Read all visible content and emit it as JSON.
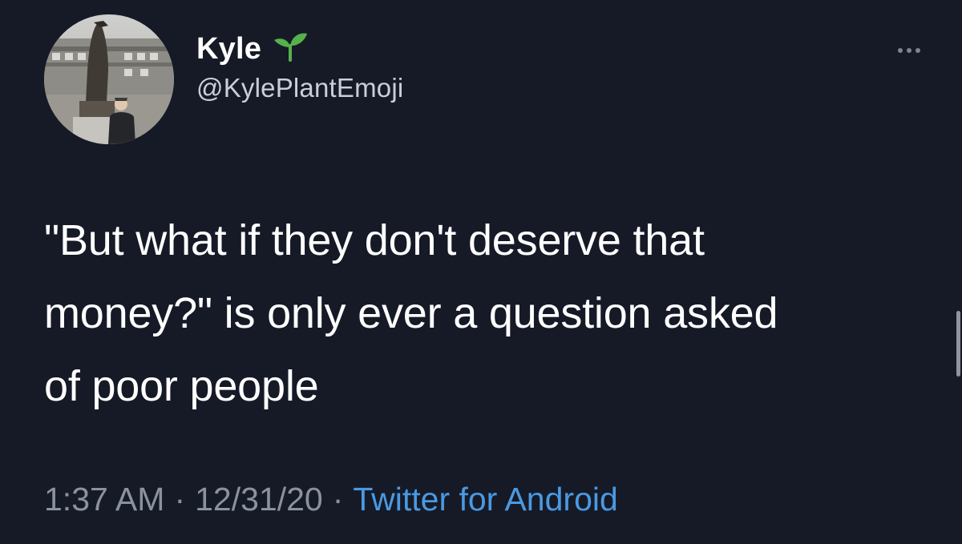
{
  "tweet": {
    "display_name": "Kyle",
    "handle": "@KylePlantEmoji",
    "badge_icon": "seedling-icon",
    "text": "\"But what if they don't deserve that\nmoney?\" is only ever a question asked\nof poor people",
    "time": "1:37 AM",
    "date": "12/31/20",
    "separator": "·",
    "source": "Twitter for Android"
  },
  "colors": {
    "background": "#161a27",
    "text": "#ffffff",
    "secondary": "#8a929f",
    "link": "#4a99e2",
    "plant": "#57b14a"
  },
  "icons": {
    "more": "more-horizontal-icon",
    "avatar": "avatar-statue-photo"
  }
}
